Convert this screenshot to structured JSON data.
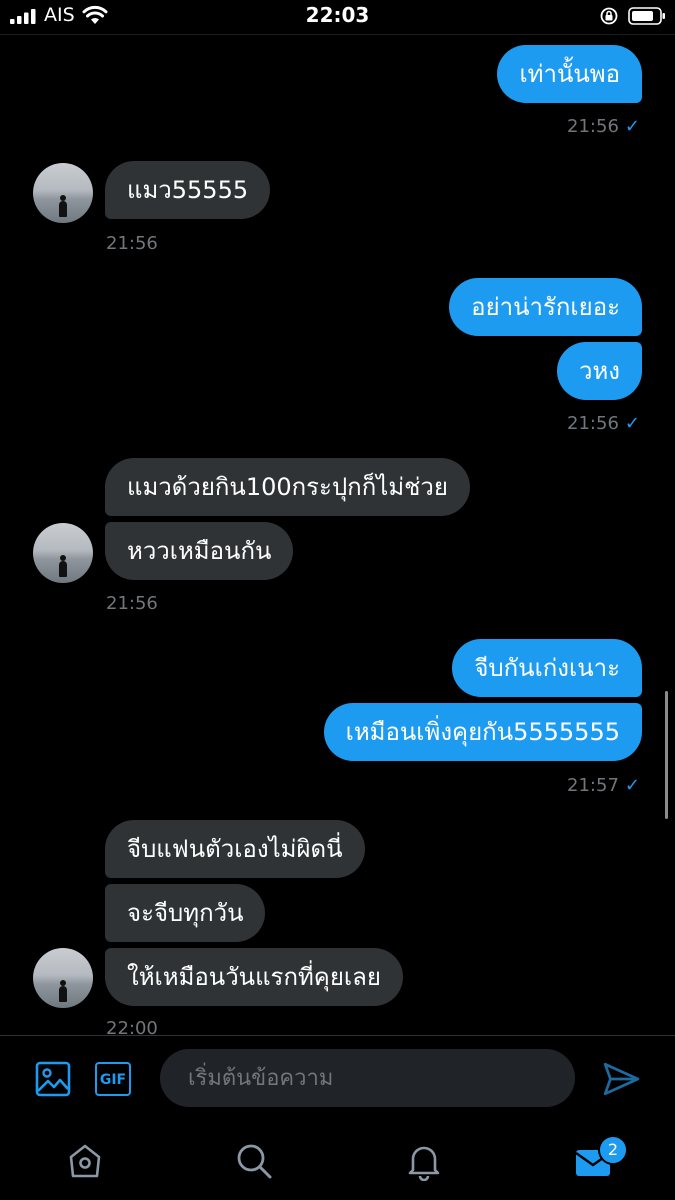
{
  "status_bar": {
    "carrier": "AIS",
    "time": "22:03",
    "icons": [
      "signal-icon",
      "wifi-icon",
      "orientation-lock-icon",
      "battery-icon"
    ]
  },
  "colors": {
    "outgoing_bubble": "#1d9bf0",
    "incoming_bubble": "#2f3336",
    "background": "#000000",
    "timestamp": "#71767b"
  },
  "messages": [
    {
      "direction": "out",
      "text": "เท่านั้นพอ"
    },
    {
      "direction": "out",
      "time": "21:56",
      "read_check": "✓"
    },
    {
      "direction": "in",
      "text": "แมว55555"
    },
    {
      "direction": "in",
      "time": "21:56"
    },
    {
      "direction": "out",
      "text": "อย่าน่ารักเยอะ"
    },
    {
      "direction": "out",
      "text": "วหง"
    },
    {
      "direction": "out",
      "time": "21:56",
      "read_check": "✓"
    },
    {
      "direction": "in",
      "text": "แมวด้วยกิน100กระปุกก็ไม่ช่วย"
    },
    {
      "direction": "in",
      "text": "หววเหมือนกัน"
    },
    {
      "direction": "in",
      "time": "21:56"
    },
    {
      "direction": "out",
      "text": "จีบกันเก่งเนาะ"
    },
    {
      "direction": "out",
      "text": "เหมือนเพิ่งคุยกัน5555555"
    },
    {
      "direction": "out",
      "time": "21:57",
      "read_check": "✓"
    },
    {
      "direction": "in",
      "text": "จีบแฟนตัวเองไม่ผิดนี่"
    },
    {
      "direction": "in",
      "text": "จะจีบทุกวัน"
    },
    {
      "direction": "in",
      "text": "ให้เหมือนวันแรกที่คุยเลย"
    },
    {
      "direction": "in",
      "time": "22:00"
    }
  ],
  "composer": {
    "placeholder": "เริ่มต้นข้อความ",
    "gif_label": "GIF",
    "icons": [
      "image-icon",
      "gif-icon",
      "send-icon"
    ]
  },
  "tab_bar": {
    "tabs": [
      "home-icon",
      "search-icon",
      "notifications-icon",
      "messages-icon"
    ],
    "messages_badge": "2"
  }
}
